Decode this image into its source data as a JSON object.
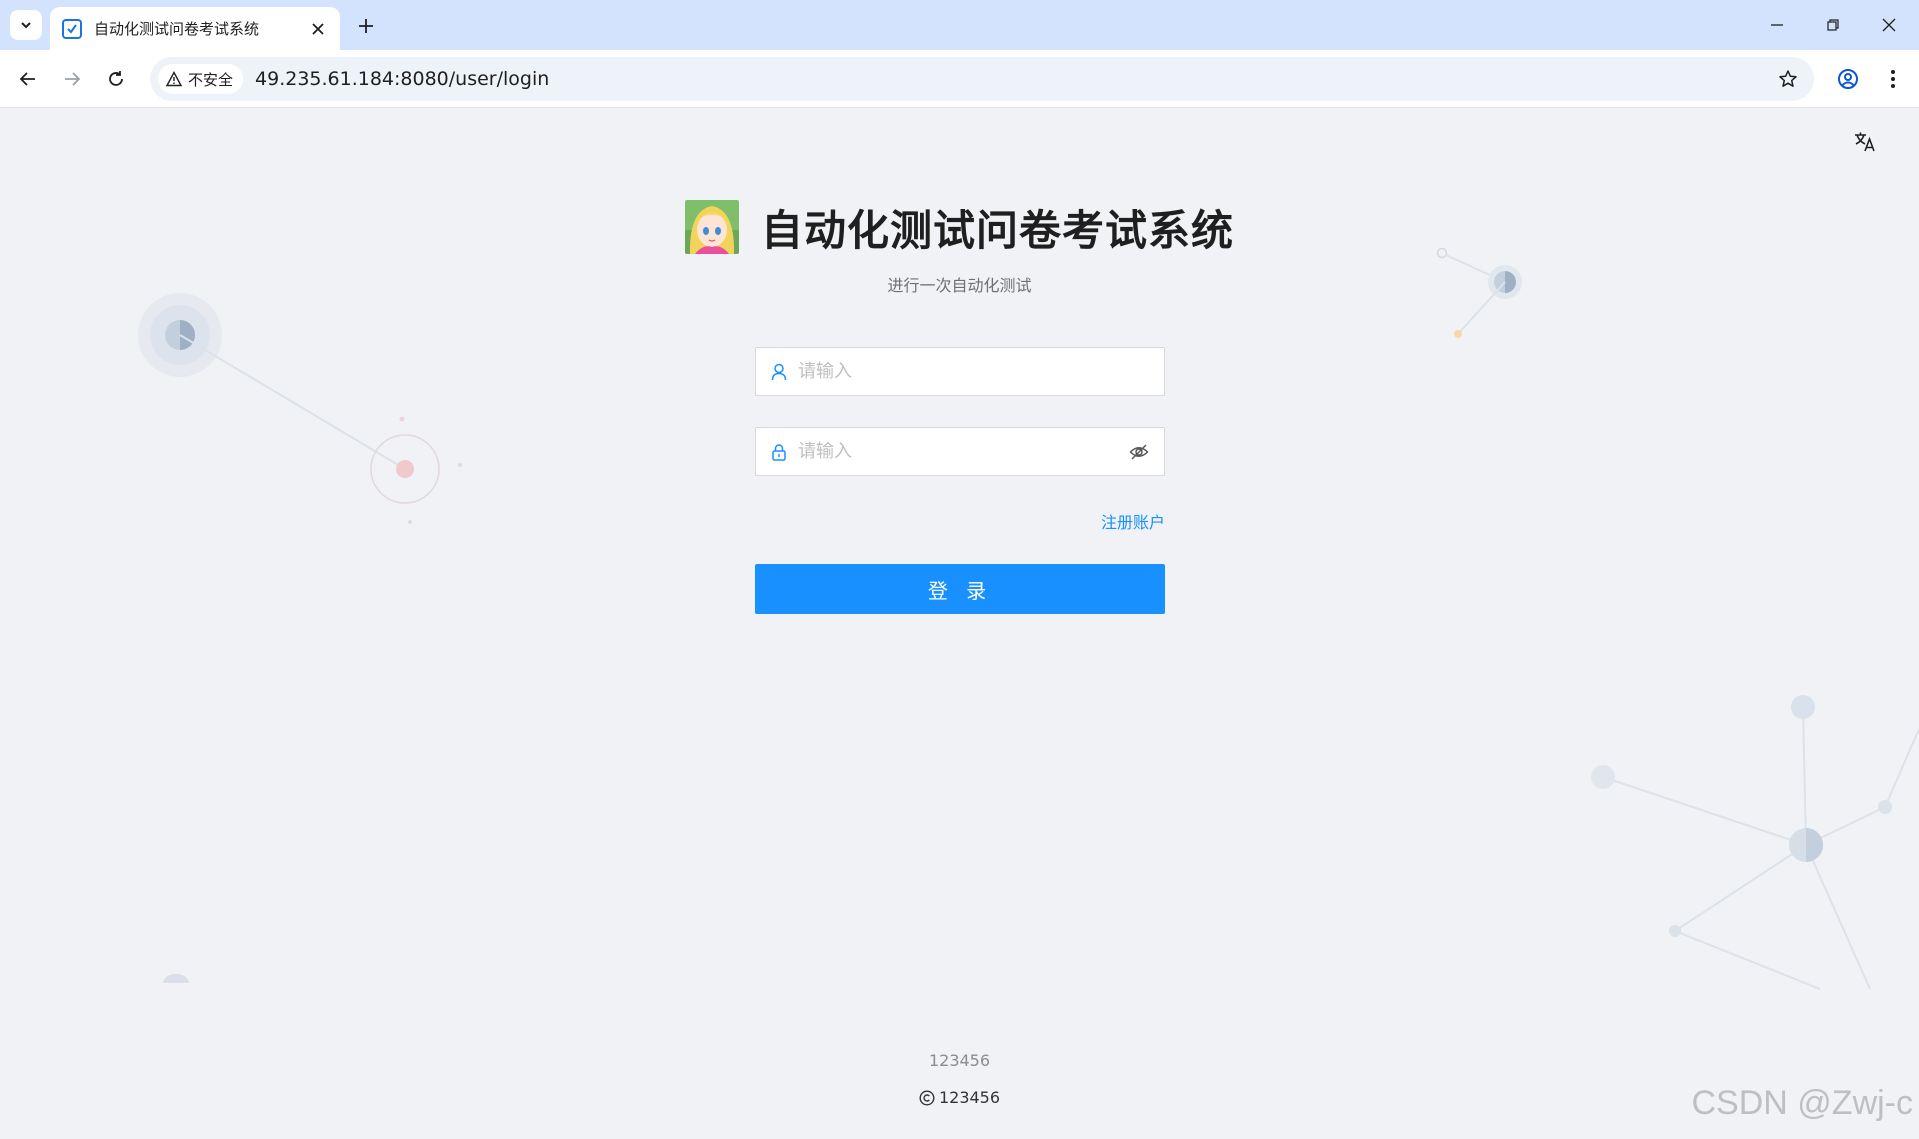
{
  "browser": {
    "tab_title": "自动化测试问卷考试系统",
    "security_label": "不安全",
    "url": "49.235.61.184:8080/user/login"
  },
  "page": {
    "title": "自动化测试问卷考试系统",
    "subtitle": "进行一次自动化测试",
    "username_placeholder": "请输入",
    "password_placeholder": "请输入",
    "register_link": "注册账户",
    "login_button": "登 录",
    "footer_line1": "123456",
    "footer_line2": "123456",
    "watermark": "CSDN @Zwj-c"
  },
  "colors": {
    "primary": "#1890ff",
    "background": "#f0f2f5",
    "tabbar": "#d3e3fd"
  }
}
